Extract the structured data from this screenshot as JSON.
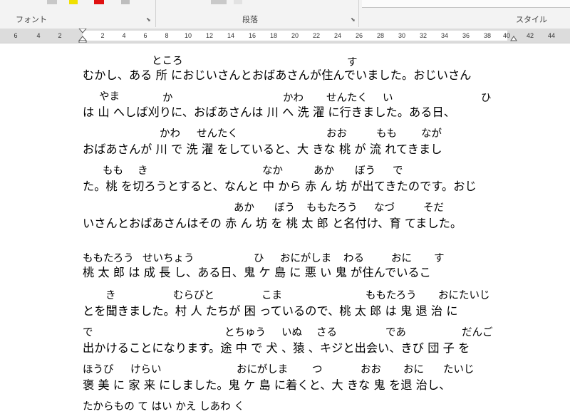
{
  "ribbon": {
    "groups": [
      {
        "label": "フォント"
      },
      {
        "label": "段落"
      },
      {
        "label": "スタイル"
      }
    ]
  },
  "ruler": {
    "ticks": [
      "6",
      "4",
      "2",
      "2",
      "4",
      "6",
      "8",
      "10",
      "12",
      "14",
      "16",
      "18",
      "20",
      "22",
      "24",
      "26",
      "28",
      "30",
      "32",
      "34",
      "36",
      "38",
      "40",
      "42",
      "44"
    ]
  },
  "document": {
    "lines": [
      "むかし、ある 所 におじいさんとおばあさんが住んでいました。おじいさん",
      "は 山 へしば刈りに、おばあさんは 川 へ 洗 濯 に行きました。ある日、",
      "おばあさんが 川 で 洗 濯 をしていると、大 きな 桃 が 流 れてきまし",
      "た。桃 を切ろうとすると、なんと 中 から 赤 ん 坊 が出てきたのです。おじ",
      "いさんとおばあさんはその 赤 ん 坊 を 桃 太 郎 と名付け、育 てました。",
      " 桃 太 郎 は 成 長 し、ある日、鬼 ケ 島 に 悪 い 鬼 が住んでいるこ",
      "とを聞きました。村 人 たちが 困 っているので、桃 太 郎 は 鬼 退 治 に",
      "出かけることになります。途 中 で 犬 、猿 、キジと出会い、きび 団 子 を",
      " 褒 美 に 家 来 にしました。鬼 ケ 島 に着くと、大 きな 鬼 を退 治し、",
      "たからもの て はい かえ しあわ く"
    ],
    "ruby": [
      [
        "ところ",
        "す"
      ],
      [
        "やま",
        "か",
        "かわ",
        "せんたく",
        "い",
        "ひ"
      ],
      [
        "かわ",
        "せんたく",
        "おお",
        "もも",
        "なが"
      ],
      [
        "もも",
        "き",
        "なか",
        "あか",
        "ぼう",
        "で"
      ],
      [
        "あか",
        "ぼう",
        "ももたろう",
        "なづ",
        "そだ"
      ],
      [
        "ももたろう",
        "せいちょう",
        "ひ",
        "おにがしま",
        "わる",
        "おに",
        "す"
      ],
      [
        "き",
        "むらびと",
        "こま",
        "ももたろう",
        "おにたいじ"
      ],
      [
        "で",
        "とちゅう",
        "いぬ",
        "さる",
        "であ",
        "だんご"
      ],
      [
        "ほうび",
        "けらい",
        "おにがしま",
        "つ",
        "おお",
        "おに",
        "たいじ"
      ]
    ]
  }
}
